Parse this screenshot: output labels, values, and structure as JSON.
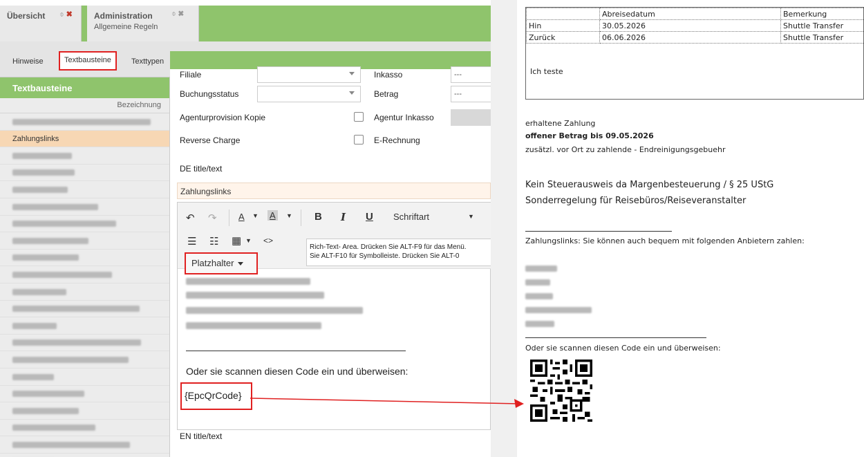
{
  "tabs": [
    {
      "title": "Übersicht",
      "subtitle": "",
      "pin": "⌽",
      "close": "✖"
    },
    {
      "title": "Administration",
      "subtitle": "Allgemeine Regeln",
      "pin": "⌽",
      "close": "✖"
    }
  ],
  "subtabs": [
    "Hinweise",
    "Textbausteine",
    "Texttypen"
  ],
  "sidebar": {
    "title": "Textbausteine",
    "column": "Bezeichnung",
    "active_item": "Zahlungslinks"
  },
  "form": {
    "rows": [
      {
        "label": "Filiale",
        "right_label": "Inkasso",
        "right_value": "---"
      },
      {
        "label": "Buchungsstatus",
        "right_label": "Betrag",
        "right_value": "---"
      },
      {
        "label": "Agenturprovision Kopie",
        "right_label": "Agentur Inkasso"
      },
      {
        "label": "Reverse Charge",
        "right_label": "E-Rechnung"
      }
    ],
    "de_label": "DE title/text",
    "title_value": "Zahlungslinks",
    "en_label": "EN title/text"
  },
  "editor": {
    "toolbar": {
      "undo": "↶",
      "redo": "↷",
      "font_color": "A",
      "bg_color": "A",
      "bold": "B",
      "italic": "I",
      "underline": "U",
      "font_label": "Schriftart",
      "bullets": "☰",
      "numbers": "☷",
      "table": "▦",
      "code": "<>"
    },
    "tooltip_line1": "Rich-Text- Area. Drücken Sie ALT-F9 für das Menü.",
    "tooltip_line2": "Sie ALT-F10 für Symbolleiste. Drücken Sie ALT-0",
    "placeholder_button": "Platzhalter",
    "scan_text": "Oder sie scannen diesen Code ein und überweisen:",
    "qr_token": "{EpcQrCode}"
  },
  "document": {
    "table": {
      "header": [
        "",
        "Abreisedatum",
        "Bemerkung"
      ],
      "rows": [
        [
          "Hin",
          "30.05.2026",
          "Shuttle Transfer"
        ],
        [
          "Zurück",
          "06.06.2026",
          "Shuttle Transfer"
        ]
      ]
    },
    "note": "Ich teste",
    "payment_received": "erhaltene Zahlung",
    "open_amount": "offener Betrag bis 09.05.2026",
    "extra_fee": "zusätzl. vor Ort zu zahlende - Endreinigungsgebuehr",
    "tax_line1": "Kein Steuerausweis da Margenbesteuerung / § 25 UStG",
    "tax_line2": "Sonderregelung für Reisebüros/Reiseveranstalter",
    "links_intro": "Zahlungslinks: Sie können auch bequem mit folgenden Anbietern zahlen:",
    "scan_text": "Oder sie scannen diesen Code ein und überweisen:"
  },
  "colors": {
    "accent_green": "#8fc46c",
    "highlight_red": "#e02020",
    "active_row": "#f7d7b4"
  }
}
